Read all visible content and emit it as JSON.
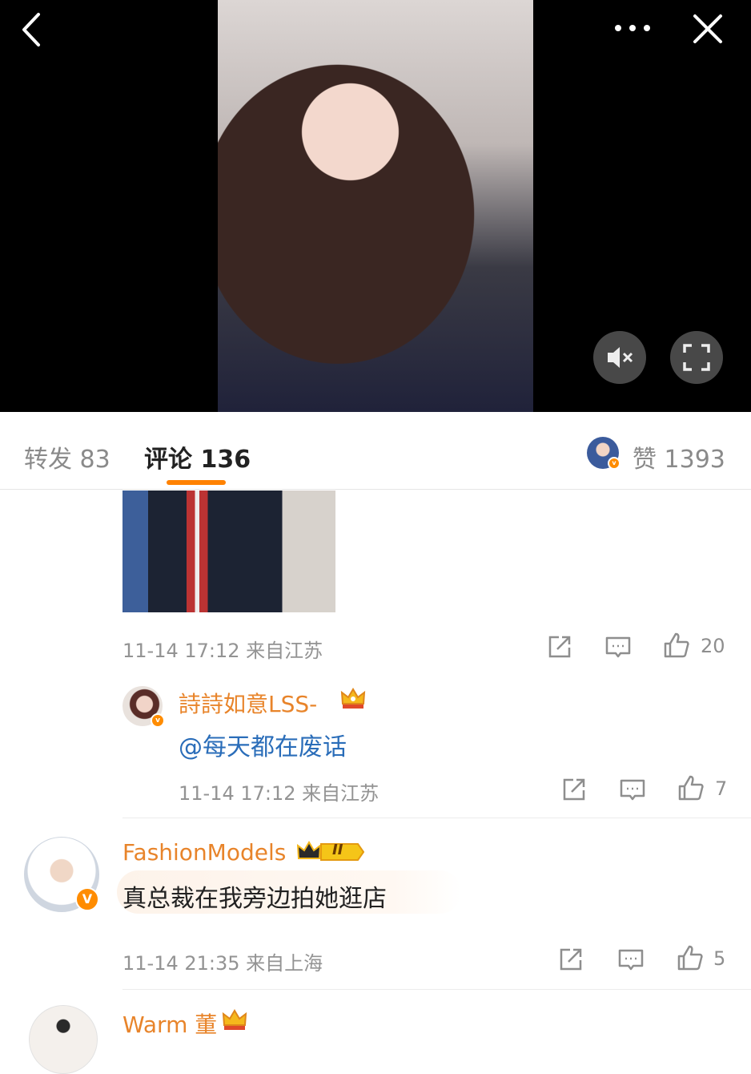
{
  "header": {
    "tabs": [
      {
        "label": "转发",
        "count": "83"
      },
      {
        "label": "评论",
        "count": "136"
      }
    ],
    "likes": {
      "label": "赞",
      "count": "1393"
    }
  },
  "comments": [
    {
      "meta": "11-14 17:12 来自江苏",
      "likes": "20",
      "reply": {
        "username": "詩詩如意LSS-",
        "mention": "@每天都在废话",
        "meta": "11-14 17:12 来自江苏",
        "likes": "7"
      }
    },
    {
      "username": "FashionModels",
      "level_badge": "II",
      "text": "真总裁在我旁边拍她逛店",
      "meta": "11-14 21:35 来自上海",
      "likes": "5"
    },
    {
      "username": "Warm 董"
    }
  ],
  "colors": {
    "accent": "#ff8200",
    "username": "#e8842a",
    "mention": "#2a6db9",
    "muted": "#8e8e8e"
  },
  "icons": [
    "back-icon",
    "more-icon",
    "close-icon",
    "mute-icon",
    "fullscreen-icon",
    "repost-icon",
    "comment-icon",
    "like-icon",
    "crown-icon",
    "verified-icon"
  ]
}
